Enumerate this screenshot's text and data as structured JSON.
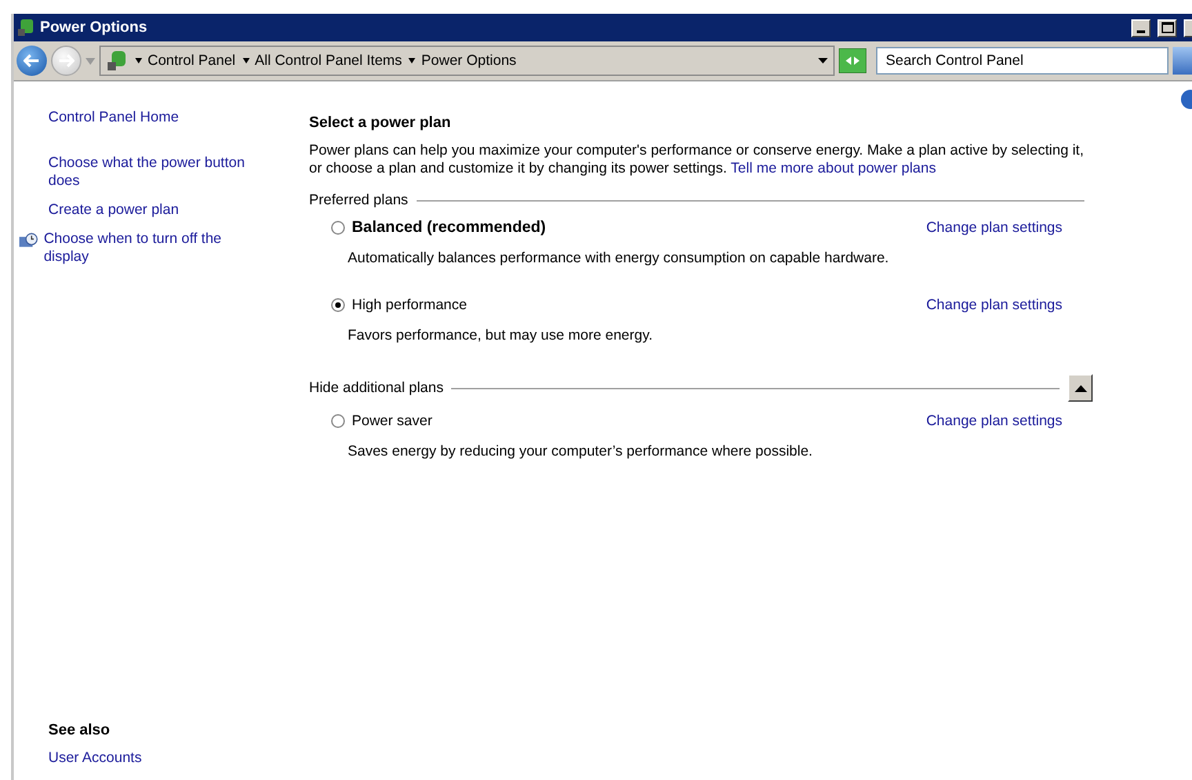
{
  "window": {
    "title": "Power Options"
  },
  "address_bar": {
    "breadcrumbs": [
      "Control Panel",
      "All Control Panel Items",
      "Power Options"
    ]
  },
  "search": {
    "placeholder": "Search Control Panel"
  },
  "sidebar": {
    "links": [
      {
        "label": "Control Panel Home",
        "kind": "plain"
      },
      {
        "label": "Choose what the power button does",
        "kind": "plain"
      },
      {
        "label": "Create a power plan",
        "kind": "plain"
      },
      {
        "label": "Choose when to turn off the display",
        "kind": "icon"
      }
    ],
    "see_also_heading": "See also",
    "see_also_links": [
      "User Accounts"
    ]
  },
  "content": {
    "title": "Select a power plan",
    "intro": "Power plans can help you maximize your computer's performance or conserve energy. Make a plan active by selecting it, or choose a plan and customize it by changing its power settings.",
    "intro_link": "Tell me more about power plans",
    "groups": [
      {
        "heading": "Preferred plans",
        "expanded": false,
        "plans": [
          {
            "name": "Balanced (recommended)",
            "emphasized": true,
            "selected": false,
            "action": "Change plan settings",
            "description": "Automatically balances performance with energy consumption on capable hardware."
          },
          {
            "name": "High performance",
            "emphasized": false,
            "selected": true,
            "action": "Change plan settings",
            "description": "Favors performance, but may use more energy."
          }
        ]
      },
      {
        "heading": "Hide additional plans",
        "expanded": true,
        "plans": [
          {
            "name": "Power saver",
            "emphasized": false,
            "selected": false,
            "action": "Change plan settings",
            "description": "Saves energy by reducing your computer’s performance where possible."
          }
        ]
      }
    ]
  }
}
